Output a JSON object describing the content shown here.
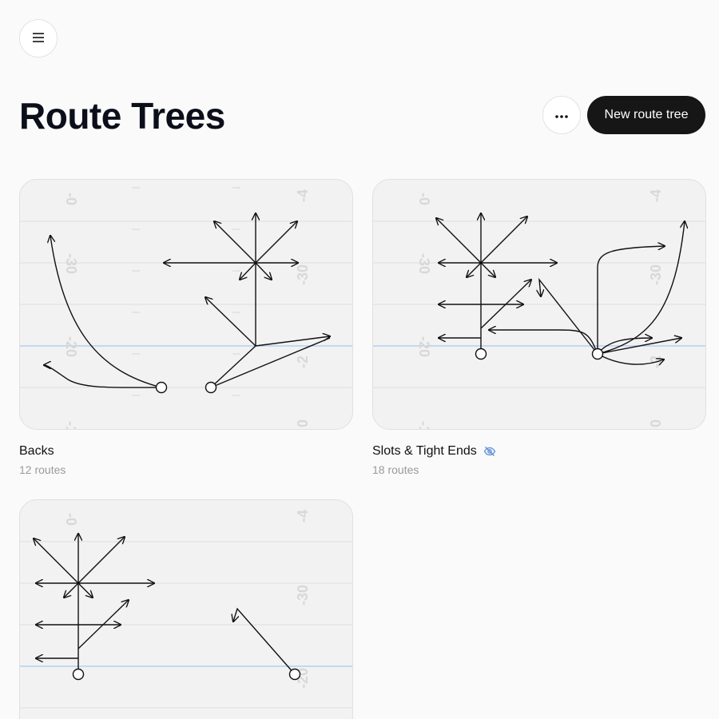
{
  "header": {
    "menu_icon": "hamburger-menu-icon",
    "title": "Route Trees",
    "more_icon": "ellipsis-icon",
    "new_button_label": "New route tree"
  },
  "cards": [
    {
      "title": "Backs",
      "subtitle": "12 routes",
      "hidden": false
    },
    {
      "title": "Slots & Tight Ends",
      "subtitle": "18 routes",
      "hidden": true,
      "status_icon": "eye-off-icon"
    },
    {
      "title": "",
      "subtitle": "",
      "hidden": false
    }
  ],
  "field": {
    "yard_numbers_card1": [
      "0",
      "30",
      "20",
      "1",
      "4",
      "30",
      "2",
      "0"
    ],
    "colors": {
      "line": "#dedede",
      "los": "#a8c8ee",
      "numbers": "#dcdcdc",
      "route": "#111111"
    }
  }
}
